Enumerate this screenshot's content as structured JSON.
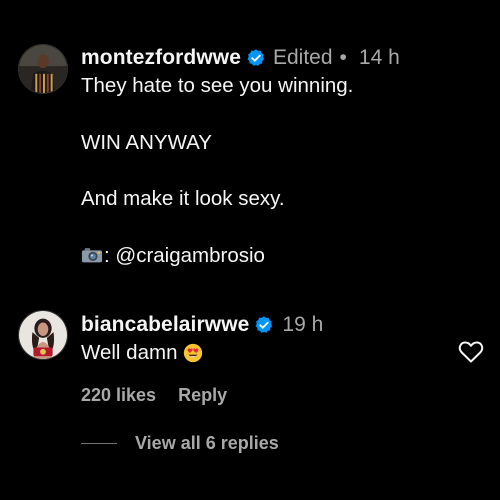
{
  "comment": {
    "username": "montezfordwwe",
    "verified": true,
    "edited_label": "Edited",
    "separator": "•",
    "time": "14 h",
    "lines": {
      "l1": "They hate to see you winning.",
      "l2": "WIN ANYWAY",
      "l3": "And make it look sexy.",
      "l4": ": @craigambrosio"
    }
  },
  "reply": {
    "username": "biancabelairwwe",
    "verified": true,
    "time": "19 h",
    "text": "Well damn",
    "emoji": "smiling-face-with-heart-eyes",
    "likes": "220 likes",
    "reply_label": "Reply"
  },
  "view_replies": {
    "label": "View all 6 replies"
  },
  "colors": {
    "background": "#000000",
    "primary_text": "#f5f5f5",
    "secondary_text": "#a8a8a8",
    "verified_blue": "#0095f6"
  }
}
